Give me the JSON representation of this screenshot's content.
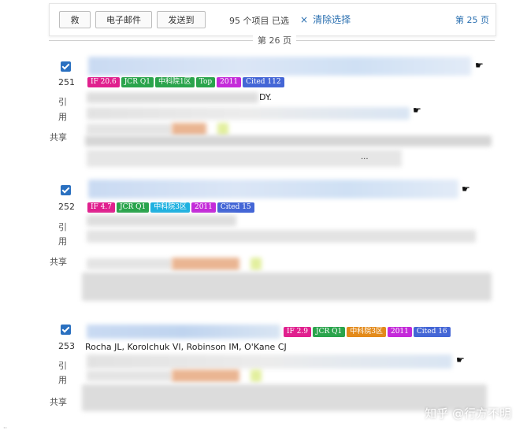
{
  "toolbar": {
    "save_label": "救",
    "email_label": "电子邮件",
    "send_label": "发送到",
    "selected_count": "95 个项目 已选",
    "clear_icon": "×",
    "clear_label": "清除选择",
    "prev_page_label": "第 25 页"
  },
  "page_divider_label": "第 26 页",
  "records": [
    {
      "number": "251",
      "cite_label_1": "引",
      "cite_label_2": "用",
      "share_label": "共享",
      "badges": [
        {
          "text": "IF 20.6",
          "color": "#e0208e"
        },
        {
          "text": "JCR Q1",
          "color": "#2aa44c"
        },
        {
          "text": "中科院1区",
          "color": "#2aa44c"
        },
        {
          "text": "Top",
          "color": "#2aa44c"
        },
        {
          "text": "2011",
          "color": "#c42ad9"
        },
        {
          "text": "Cited 112",
          "color": "#4466d6"
        }
      ],
      "author_tail": "DY.",
      "trunc_tail": "..."
    },
    {
      "number": "252",
      "cite_label_1": "引",
      "cite_label_2": "用",
      "share_label": "共享",
      "badges": [
        {
          "text": "IF 4.7",
          "color": "#e0208e"
        },
        {
          "text": "JCR Q1",
          "color": "#2aa44c"
        },
        {
          "text": "中科院3区",
          "color": "#1fb1e0"
        },
        {
          "text": "2011",
          "color": "#c42ad9"
        },
        {
          "text": "Cited 15",
          "color": "#4466d6"
        }
      ]
    },
    {
      "number": "253",
      "cite_label_1": "引",
      "cite_label_2": "用",
      "share_label": "共享",
      "badges": [
        {
          "text": "IF 2.9",
          "color": "#e0208e"
        },
        {
          "text": "JCR Q1",
          "color": "#2aa44c"
        },
        {
          "text": "中科院3区",
          "color": "#e38a1a"
        },
        {
          "text": "2011",
          "color": "#c42ad9"
        },
        {
          "text": "Cited 16",
          "color": "#4466d6"
        }
      ],
      "authors": "Rocha JL, Korolchuk VI, Robinson IM, O'Kane CJ"
    }
  ],
  "watermark": "知乎 @行方不明",
  "corner_mark": "··"
}
